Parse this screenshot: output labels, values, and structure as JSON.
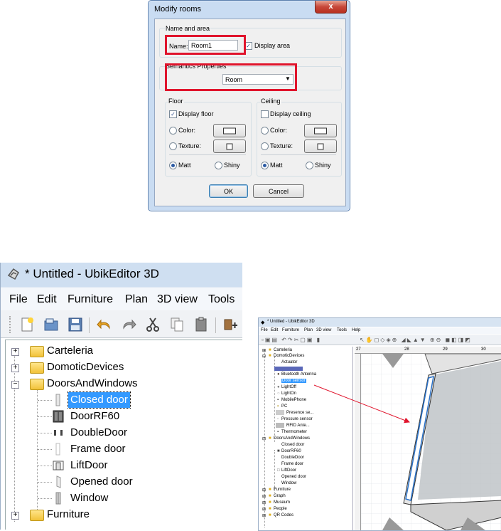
{
  "dialog": {
    "title": "Modify rooms",
    "close_glyph": "x",
    "group_name_area": "Name and area",
    "name_label": "Name:",
    "name_value": "Room1",
    "display_area_label": "Display area",
    "group_semantics": "Semantics Properties",
    "semantics_value": "Room",
    "floor_group": "Floor",
    "display_floor_label": "Display floor",
    "ceiling_group": "Ceiling",
    "display_ceiling_label": "Display ceiling",
    "color_label": "Color:",
    "texture_label": "Texture:",
    "matt_label": "Matt",
    "shiny_label": "Shiny",
    "ok_label": "OK",
    "cancel_label": "Cancel",
    "highlight_color": "#e0142c"
  },
  "editor_zoom": {
    "title": "* Untitled - UbikEditor 3D",
    "menu": [
      "File",
      "Edit",
      "Furniture",
      "Plan",
      "3D view",
      "Tools"
    ],
    "tree": {
      "carteleria": "Carteleria",
      "domotic": "DomoticDevices",
      "doors": "DoorsAndWindows",
      "closed_door": "Closed door",
      "doorrf60": "DoorRF60",
      "doubledoor": "DoubleDoor",
      "frame_door": "Frame door",
      "liftdoor": "LiftDoor",
      "opened_door": "Opened door",
      "window": "Window",
      "furniture": "Furniture"
    },
    "selection_color": "#3399ff"
  },
  "editor_small": {
    "title": "* Untitled - UbikEditor 3D",
    "menu": [
      "File",
      "Edit",
      "Furniture",
      "Plan",
      "3D view",
      "Tools",
      "Help"
    ],
    "tree": {
      "carteleria": "Carteleria",
      "domotic": "DomoticDevices",
      "actuator": "Actuator",
      "bluetooth": "Bluetooth Antenna",
      "door_sensor": "Door sensor",
      "lightoff": "LightOff",
      "lighton": "LightOn",
      "mobile": "MobilePhone",
      "pc": "PC",
      "presence": "Presence se...",
      "pressure": "Pressure sensor",
      "rfid": "RFID Ante...",
      "thermo": "Thermometer",
      "doors": "DoorsAndWindows",
      "closed_door": "Closed door",
      "doorrf60": "DoorRF60",
      "doubledoor": "DoubleDoor",
      "frame_door": "Frame door",
      "liftdoor": "LiftDoor",
      "opened_door": "Opened door",
      "window": "Window",
      "furniture": "Furniture",
      "graph": "Graph",
      "museum": "Museum",
      "people": "People",
      "qr": "QR Codes"
    },
    "ruler": [
      "27",
      "28",
      "29",
      "30"
    ],
    "arrow_color": "#e0142c"
  }
}
